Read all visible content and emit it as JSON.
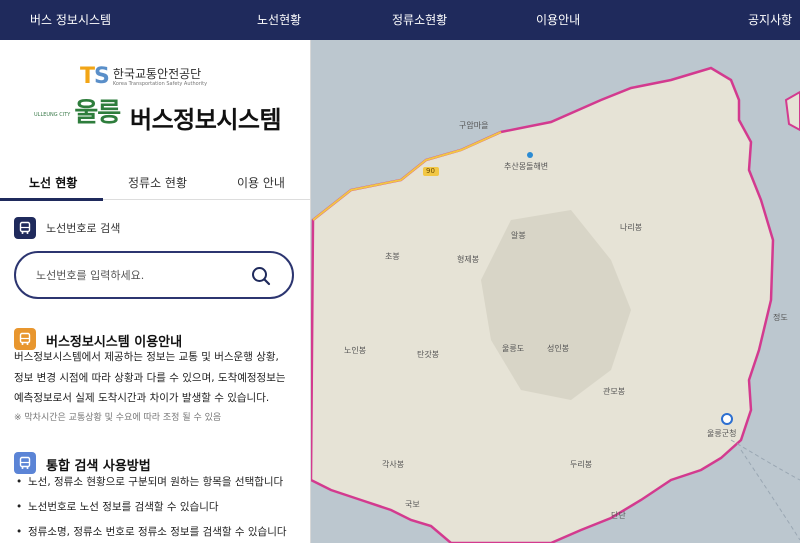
{
  "topnav": {
    "brand": "버스 정보시스템",
    "items": [
      "노선현황",
      "정류소현황",
      "이용안내",
      "공지사항"
    ]
  },
  "logo": {
    "ts_mark": "TS",
    "ts_name": "한국교통안전공단",
    "ts_sub": "Korea Transportation Safety Authority",
    "ulleung_small": "ULLEUNG CITY",
    "ulleung_main": "울릉",
    "title": "버스정보시스템"
  },
  "tabs": [
    {
      "label": "노선 현황",
      "active": true
    },
    {
      "label": "정류소 현황",
      "active": false
    },
    {
      "label": "이용 안내",
      "active": false
    }
  ],
  "route_search": {
    "label": "노선번호로 검색",
    "placeholder": "노선번호를 입력하세요."
  },
  "guide": {
    "title": "버스정보시스템 이용안내",
    "lines": [
      "버스정보시스템에서 제공하는 정보는 교통 및 버스운행 상황,",
      "정보 변경 시점에 따라 상황과 다를 수 있으며, 도착예정정보는",
      "예측정보로서 실제 도착시간과 차이가 발생할 수 있습니다."
    ],
    "note": "※ 막차시간은 교통상황 및 수요에 따라 조정 될 수 있음"
  },
  "search_help": {
    "title": "통합 검색 사용방법",
    "bullets": [
      "노선, 정류소 현황으로 구분되며 원하는 항목을 선택합니다",
      "노선번호로 노선 정보를 검색할 수 있습니다",
      "정류소명, 정류소 번호로 정류소 정보를 검색할 수 있습니다"
    ]
  },
  "map": {
    "labels": {
      "gumam": "구암마을",
      "beach": "추산몽돌해변",
      "naribong": "나리봉",
      "albong": "알봉",
      "chobong": "초봉",
      "hyeongjebong": "형제봉",
      "noinbong": "노인봉",
      "tangatbong": "탄갓봉",
      "ulleungdo": "울릉도",
      "seonginbong": "성인봉",
      "gwanmobong": "관모봉",
      "gaksabong": "각사봉",
      "durubong": "두리봉",
      "jeongdo": "정도",
      "ulleung_county": "울릉군청",
      "gukbo": "국보",
      "dandan": "단단",
      "road_num": "90"
    },
    "colors": {
      "sea": "#bcc7cf",
      "land": "#e6e3d6",
      "coast": "#d33a8f",
      "road": "#f2c744"
    }
  },
  "colors": {
    "nav": "#1f2a5c",
    "guide_icon": "#e8962e",
    "search_icon": "#5b84d6"
  }
}
